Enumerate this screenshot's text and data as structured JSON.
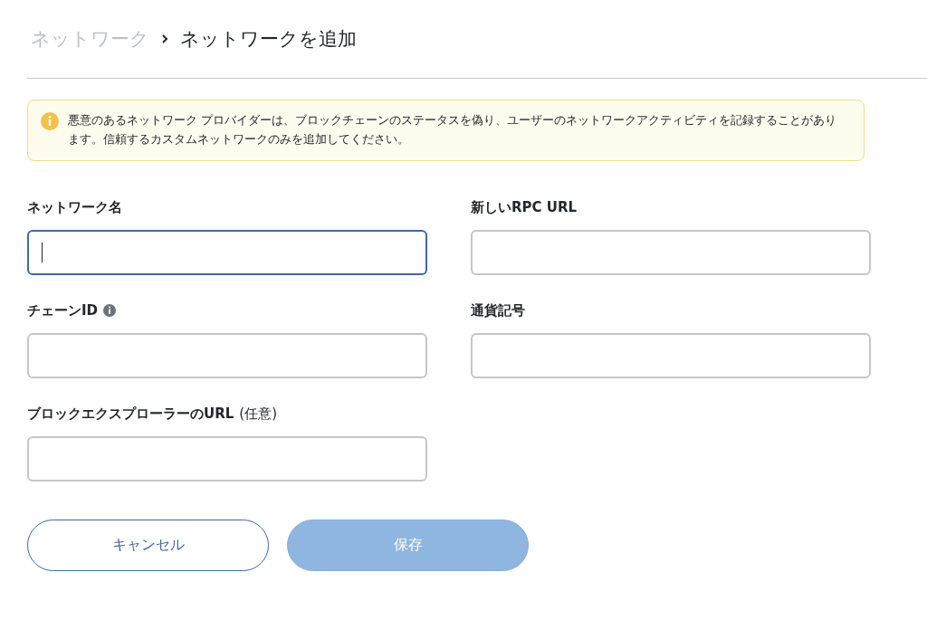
{
  "breadcrumb": [
    {
      "label": "ネットワーク",
      "current": false
    },
    {
      "label": "ネットワークを追加",
      "current": true
    }
  ],
  "warning": {
    "text": "悪意のあるネットワーク プロバイダーは、ブロックチェーンのステータスを偽り、ユーザーのネットワークアクティビティを記録することがあります。信頼するカスタムネットワークのみを追加してください。"
  },
  "fields": [
    {
      "label": "ネットワーク名",
      "focused": true
    },
    {
      "label": "新しいRPC URL",
      "focused": false
    },
    {
      "label": "チェーンID",
      "info": true,
      "focused": false
    },
    {
      "label": "通貨記号",
      "focused": false
    },
    {
      "label": "ブロックエクスプローラーのURL",
      "note": "(任意)",
      "focused": false
    }
  ],
  "buttons": [
    {
      "label": "キャンセル",
      "kind": "secondary",
      "disabled": false
    },
    {
      "label": "保存",
      "kind": "primary",
      "disabled": true
    }
  ]
}
